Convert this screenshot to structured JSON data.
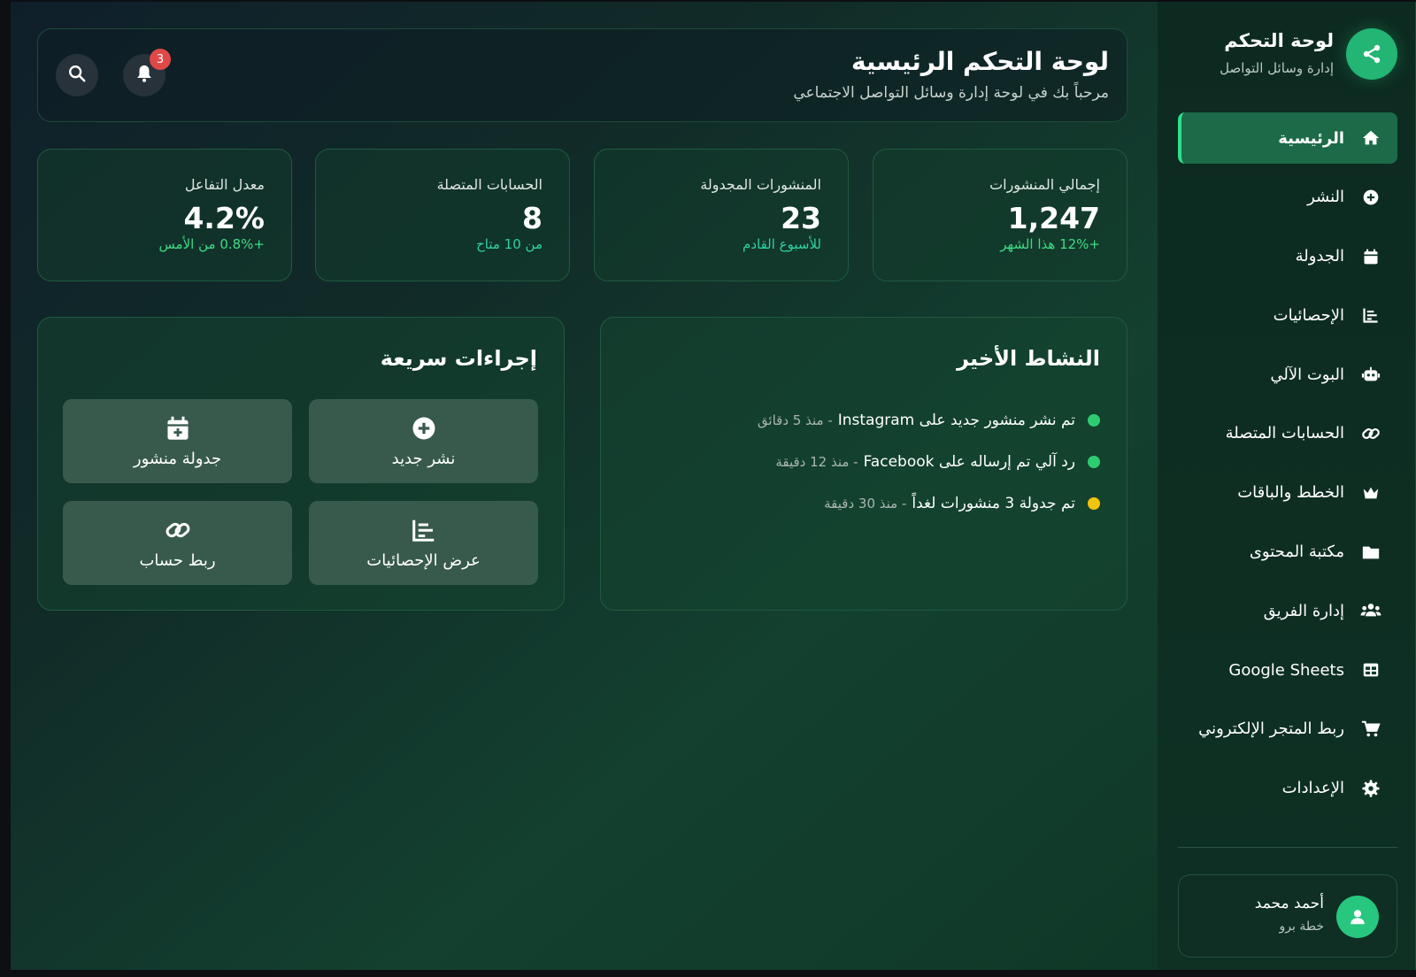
{
  "brand": {
    "title": "لوحة التحكم",
    "subtitle": "إدارة وسائل التواصل",
    "icon": "share-icon"
  },
  "nav": {
    "items": [
      {
        "label": "الرئيسية",
        "icon": "home-icon",
        "active": true
      },
      {
        "label": "النشر",
        "icon": "plus-circle-icon"
      },
      {
        "label": "الجدولة",
        "icon": "calendar-icon"
      },
      {
        "label": "الإحصائيات",
        "icon": "chart-icon"
      },
      {
        "label": "البوت الآلي",
        "icon": "robot-icon"
      },
      {
        "label": "الحسابات المتصلة",
        "icon": "link-icon"
      },
      {
        "label": "الخطط والباقات",
        "icon": "crown-icon"
      },
      {
        "label": "مكتبة المحتوى",
        "icon": "folder-icon"
      },
      {
        "label": "إدارة الفريق",
        "icon": "users-icon"
      },
      {
        "label": "Google Sheets",
        "icon": "table-icon"
      },
      {
        "label": "ربط المتجر الإلكتروني",
        "icon": "cart-icon"
      },
      {
        "label": "الإعدادات",
        "icon": "gear-icon"
      }
    ]
  },
  "user": {
    "name": "أحمد محمد",
    "plan": "خطة برو",
    "icon": "user-icon"
  },
  "header": {
    "title": "لوحة التحكم الرئيسية",
    "subtitle": "مرحباً بك في لوحة إدارة وسائل التواصل الاجتماعي",
    "notifications_count": "3"
  },
  "stats": [
    {
      "label": "إجمالي المنشورات",
      "value": "1,247",
      "note": "+12% هذا الشهر"
    },
    {
      "label": "المنشورات المجدولة",
      "value": "23",
      "note": "للأسبوع القادم"
    },
    {
      "label": "الحسابات المتصلة",
      "value": "8",
      "note": "من 10 متاح"
    },
    {
      "label": "معدل التفاعل",
      "value": "4.2%",
      "note": "+0.8% من الأمس"
    }
  ],
  "activity": {
    "title": "النشاط الأخير",
    "items": [
      {
        "text": "تم نشر منشور جديد على Instagram",
        "time": "- منذ 5 دقائق",
        "color": "#2ecc71"
      },
      {
        "text": "رد آلي تم إرساله على Facebook",
        "time": "- منذ 12 دقيقة",
        "color": "#2ecc71"
      },
      {
        "text": "تم جدولة 3 منشورات لغداً",
        "time": "- منذ 30 دقيقة",
        "color": "#f1c40f"
      }
    ]
  },
  "quick_actions": {
    "title": "إجراءات سريعة",
    "items": [
      {
        "label": "نشر جديد",
        "icon": "plus-circle-icon"
      },
      {
        "label": "جدولة منشور",
        "icon": "calendar-plus-icon"
      },
      {
        "label": "عرض الإحصائيات",
        "icon": "chart-icon"
      },
      {
        "label": "ربط حساب",
        "icon": "link-icon"
      }
    ]
  },
  "colors": {
    "accent": "#22b573",
    "active_nav": "#1c6a48",
    "positive": "#3ddc84",
    "warning": "#f1c40f",
    "badge": "#e04848"
  }
}
